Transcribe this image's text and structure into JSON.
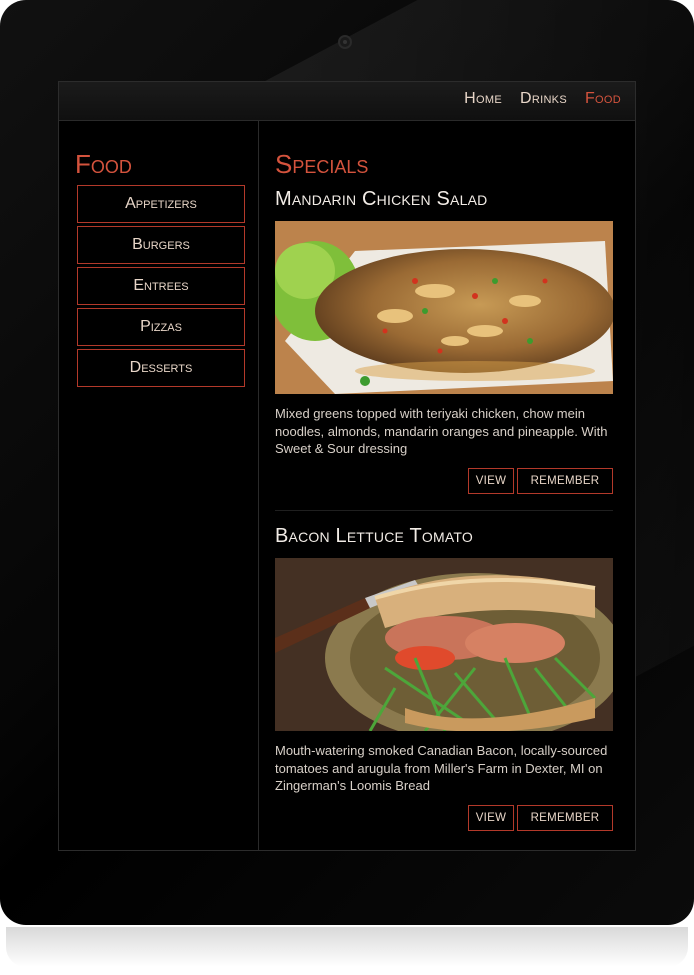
{
  "nav": {
    "items": [
      {
        "label": "Home",
        "active": false
      },
      {
        "label": "Drinks",
        "active": false
      },
      {
        "label": "Food",
        "active": true
      }
    ]
  },
  "sidebar": {
    "title": "Food",
    "items": [
      "Appetizers",
      "Burgers",
      "Entrees",
      "Pizzas",
      "Desserts"
    ]
  },
  "main": {
    "title": "Specials",
    "dishes": [
      {
        "name": "Mandarin Chicken Salad",
        "description": "Mixed greens topped with teriyaki chicken, chow mein noodles, almonds, mandarin oranges and pineapple. With Sweet & Sour dressing",
        "view_label": "View",
        "remember_label": "Remember"
      },
      {
        "name": "Bacon Lettuce Tomato",
        "description": "Mouth-watering smoked Canadian Bacon, locally-sourced tomatoes and arugula from Miller's Farm in Dexter, MI on Zingerman's Loomis Bread",
        "view_label": "View",
        "remember_label": "Remember"
      }
    ]
  },
  "colors": {
    "accent": "#d4533d",
    "border": "#b3392a",
    "text": "#e8d6c8",
    "background": "#000000"
  }
}
